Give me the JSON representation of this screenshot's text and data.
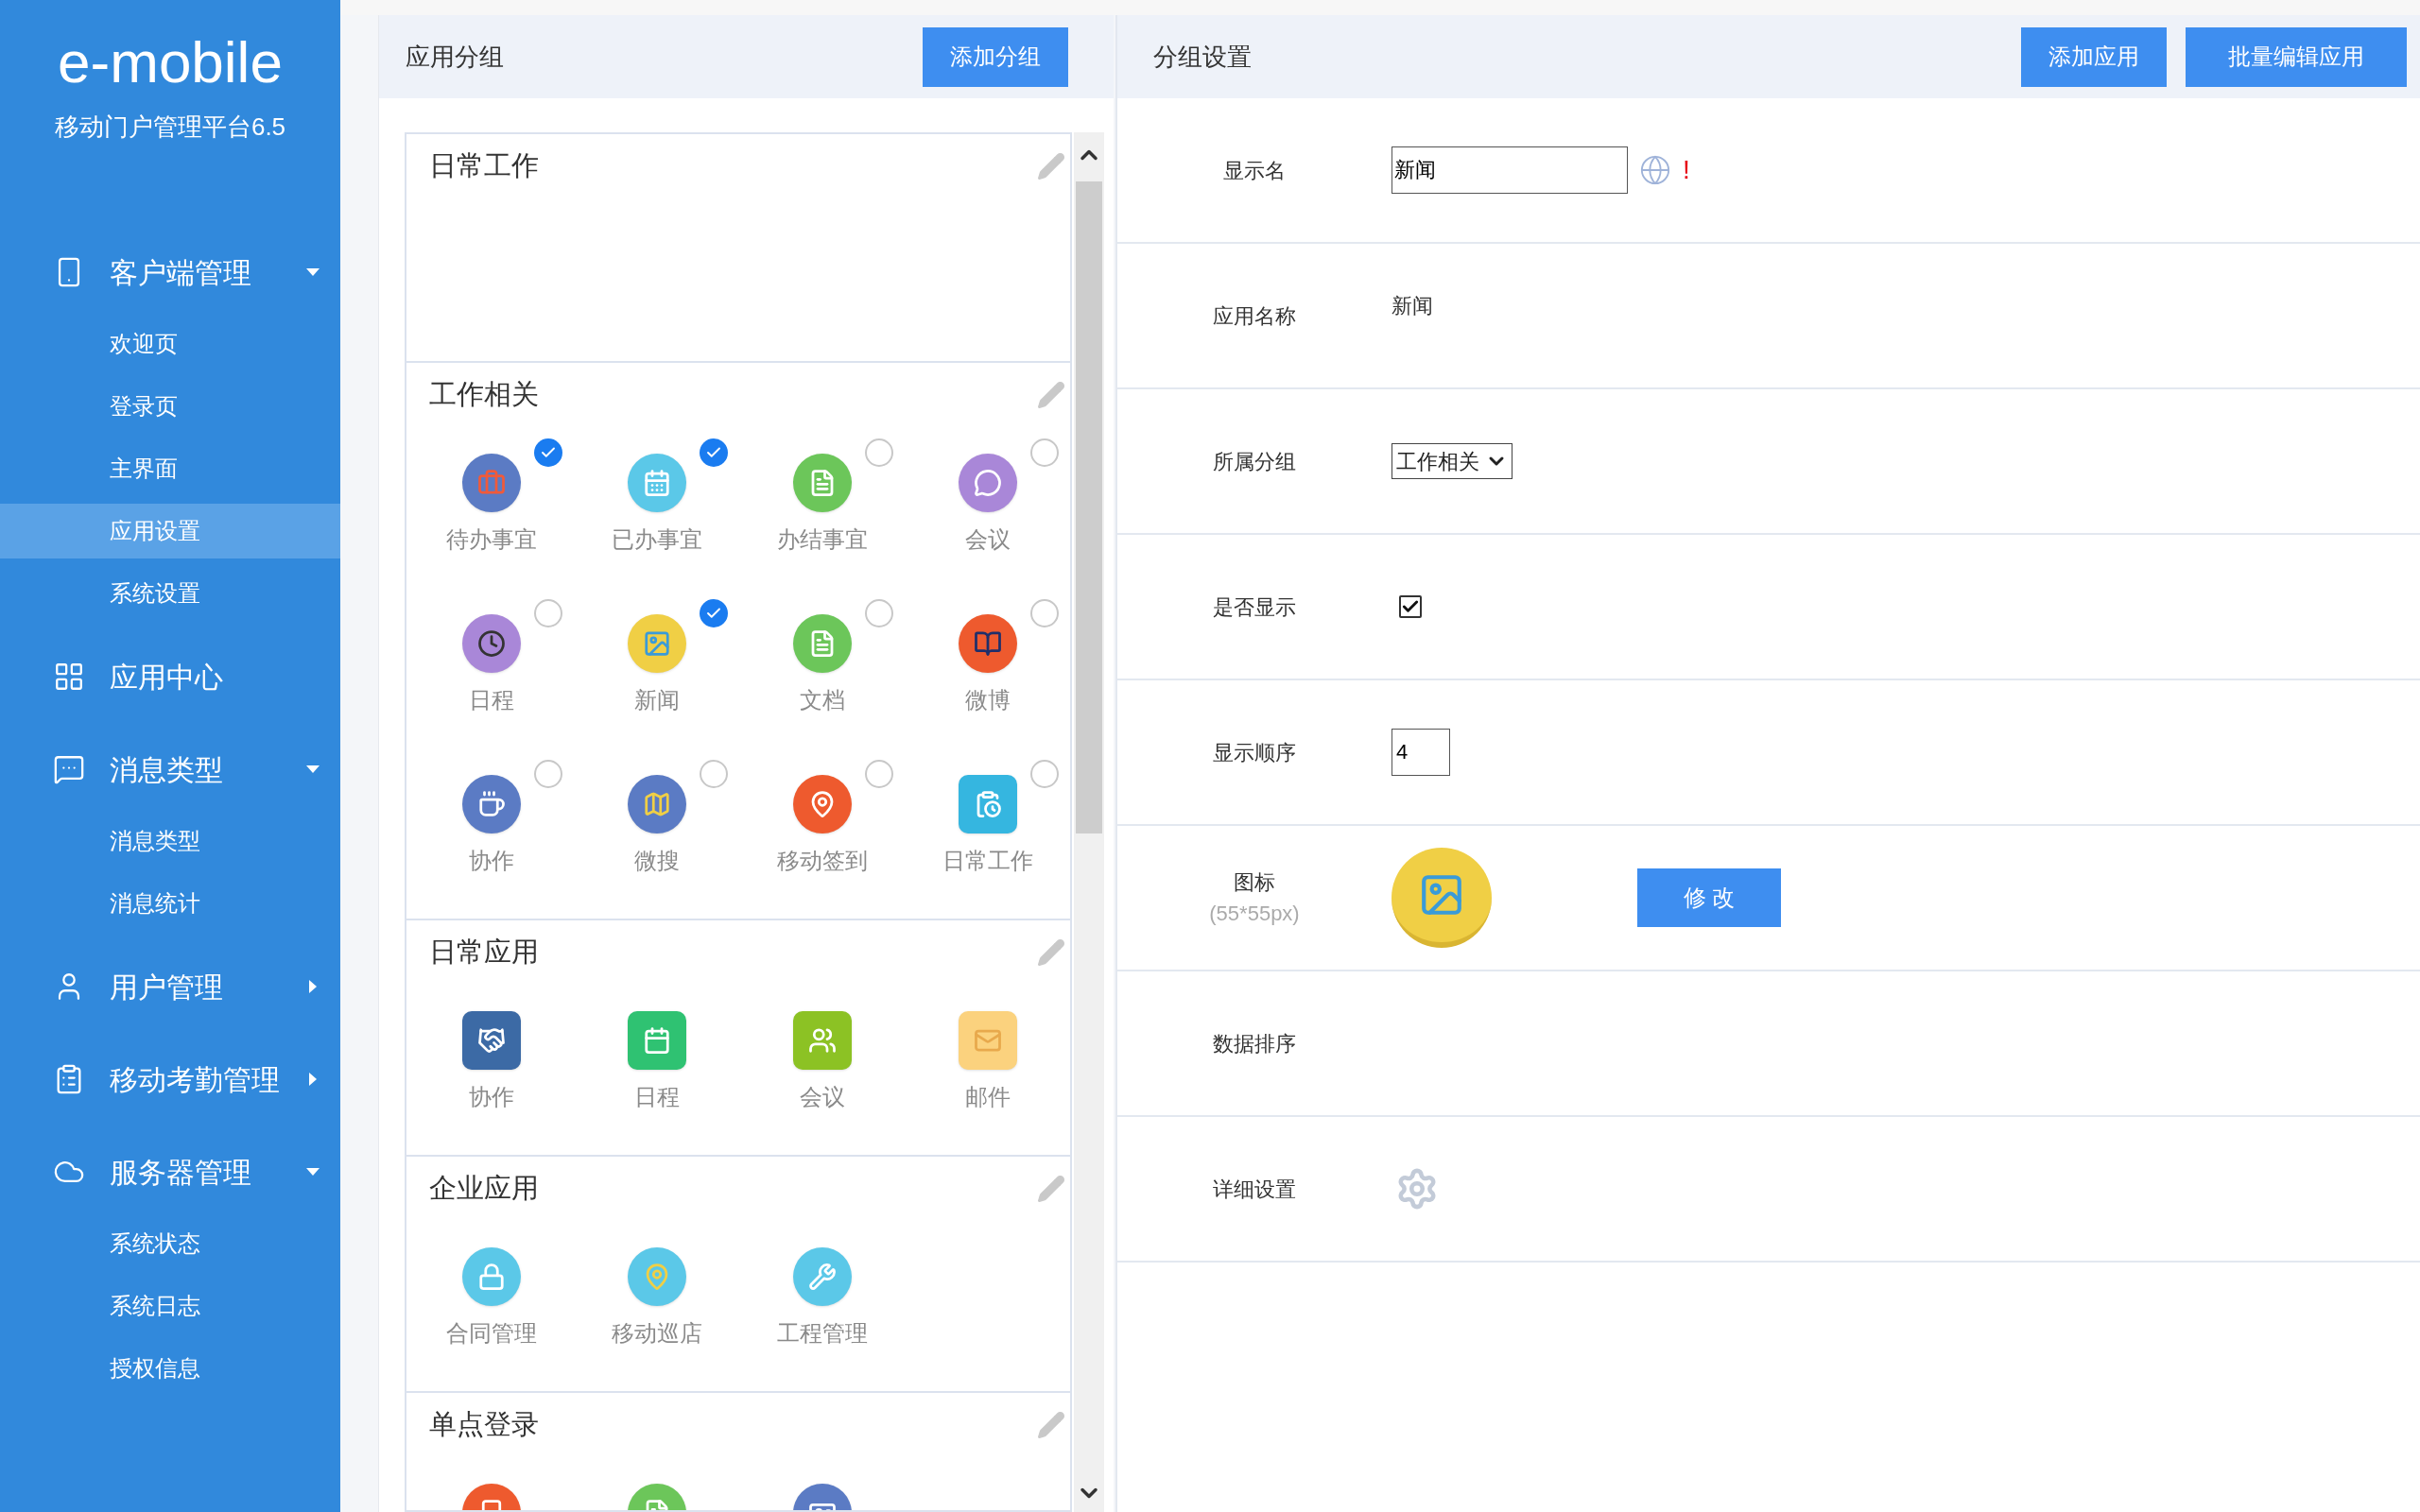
{
  "brand": {
    "logo": "e-mobile",
    "subtitle": "移动门户管理平台6.5"
  },
  "nav": [
    {
      "label": "客户端管理",
      "kind": "group",
      "expanded": true,
      "children": [
        {
          "label": "欢迎页",
          "selected": false
        },
        {
          "label": "登录页",
          "selected": false
        },
        {
          "label": "主界面",
          "selected": false
        },
        {
          "label": "应用设置",
          "selected": true
        },
        {
          "label": "系统设置",
          "selected": false
        }
      ]
    },
    {
      "label": "应用中心",
      "kind": "link"
    },
    {
      "label": "消息类型",
      "kind": "group",
      "expanded": true,
      "children": [
        {
          "label": "消息类型",
          "selected": false
        },
        {
          "label": "消息统计",
          "selected": false
        }
      ]
    },
    {
      "label": "用户管理",
      "kind": "group",
      "expanded": false
    },
    {
      "label": "移动考勤管理",
      "kind": "group",
      "expanded": false
    },
    {
      "label": "服务器管理",
      "kind": "group",
      "expanded": true,
      "children": [
        {
          "label": "系统状态",
          "selected": false
        },
        {
          "label": "系统日志",
          "selected": false
        },
        {
          "label": "授权信息",
          "selected": false
        }
      ]
    }
  ],
  "groups_panel": {
    "title": "应用分组",
    "add_button": "添加分组",
    "groups": [
      {
        "title": "日常工作"
      },
      {
        "title": "工作相关",
        "apps": [
          {
            "label": "待办事宜",
            "kind": "round",
            "checked": true
          },
          {
            "label": "已办事宜",
            "kind": "round",
            "checked": true
          },
          {
            "label": "办结事宜",
            "kind": "round",
            "checked": false
          },
          {
            "label": "会议",
            "kind": "round",
            "checked": false
          },
          {
            "label": "日程",
            "kind": "round",
            "checked": false
          },
          {
            "label": "新闻",
            "kind": "round",
            "checked": true
          },
          {
            "label": "文档",
            "kind": "round",
            "checked": false
          },
          {
            "label": "微博",
            "kind": "round",
            "checked": false
          },
          {
            "label": "协作",
            "kind": "round",
            "checked": false
          },
          {
            "label": "微搜",
            "kind": "round",
            "checked": false
          },
          {
            "label": "移动签到",
            "kind": "round",
            "checked": false
          },
          {
            "label": "日常工作",
            "kind": "square",
            "checked": false
          }
        ]
      },
      {
        "title": "日常应用",
        "apps": [
          {
            "label": "协作",
            "kind": "square"
          },
          {
            "label": "日程",
            "kind": "square"
          },
          {
            "label": "会议",
            "kind": "square"
          },
          {
            "label": "邮件",
            "kind": "square"
          }
        ]
      },
      {
        "title": "企业应用",
        "apps": [
          {
            "label": "合同管理",
            "kind": "round"
          },
          {
            "label": "移动巡店",
            "kind": "round"
          },
          {
            "label": "工程管理",
            "kind": "round"
          }
        ]
      },
      {
        "title": "单点登录",
        "apps": [
          {
            "kind": "round"
          },
          {
            "kind": "round"
          },
          {
            "kind": "round"
          }
        ]
      }
    ]
  },
  "settings_panel": {
    "title": "分组设置",
    "buttons": [
      "添加应用",
      "批量编辑应用"
    ],
    "rows": [
      {
        "kind": "text_input",
        "label": "显示名",
        "value": "新闻",
        "required_mark": "!"
      },
      {
        "kind": "text",
        "label": "应用名称",
        "value": "新闻"
      },
      {
        "kind": "select",
        "label": "所属分组",
        "value": "工作相关"
      },
      {
        "kind": "checkbox",
        "label": "是否显示",
        "checked": true
      },
      {
        "kind": "number_input",
        "label": "显示顺序",
        "value": "4"
      },
      {
        "kind": "icon",
        "label": "图标",
        "hint": "(55*55px)",
        "button": "修 改"
      },
      {
        "kind": "empty",
        "label": "数据排序"
      },
      {
        "kind": "gear",
        "label": "详细设置"
      }
    ]
  }
}
